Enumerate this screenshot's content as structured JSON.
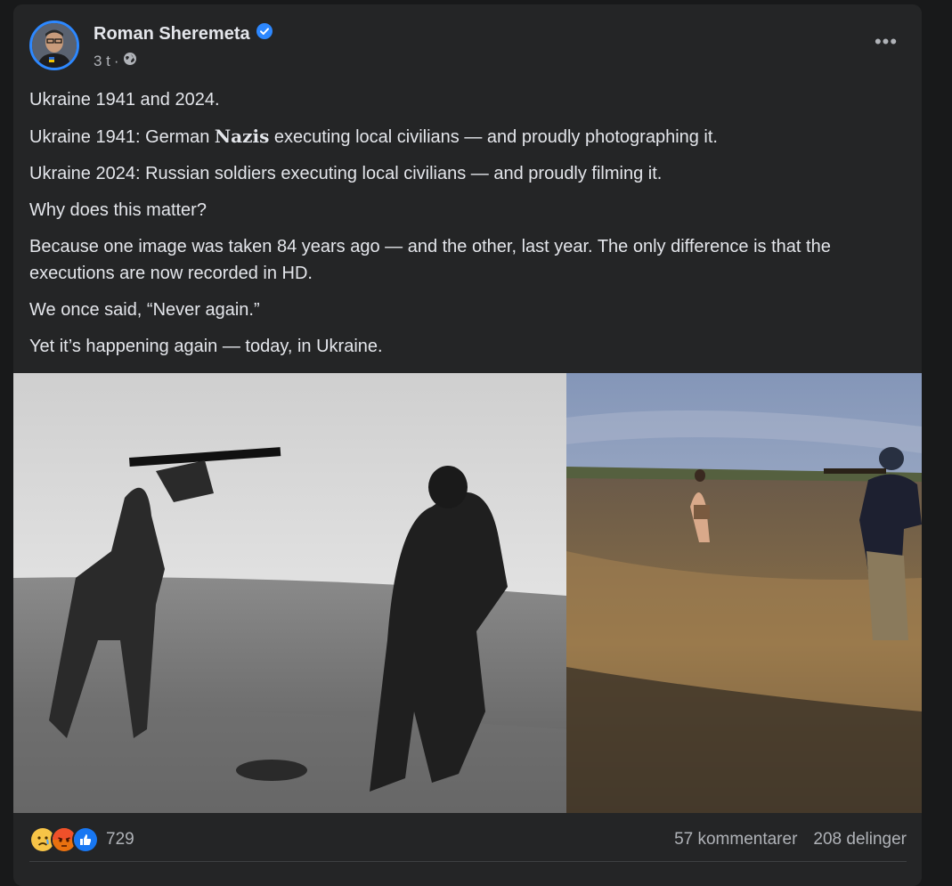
{
  "post": {
    "author": "Roman Sheremeta",
    "time": "3 t",
    "separator": "·",
    "paragraphs": {
      "p1": "Ukraine 1941 and 2024.",
      "p2_a": "Ukraine 1941: German ",
      "p2_b": "Nazis",
      "p2_c": " executing local civilians — and proudly photographing it.",
      "p3": "Ukraine 2024: Russian soldiers executing local civilians — and proudly filming it.",
      "p4": "Why does this matter?",
      "p5": "Because one image was taken 84 years ago — and the other, last year. The only difference is that the executions are now recorded in HD.",
      "p6": "We once said, “Never again.”",
      "p7": "Yet it’s happening again — today, in Ukraine."
    },
    "reaction_count": "729",
    "comments": "57 kommentarer",
    "shares": "208 delinger",
    "icons": {
      "verified": "verified-badge-icon",
      "audience": "globe-icon",
      "menu": "more-options-icon",
      "reactions": [
        "sad-reaction-icon",
        "angry-reaction-icon",
        "like-reaction-icon"
      ]
    },
    "colors": {
      "accent": "#2d88ff",
      "bg": "#242526",
      "text": "#e4e6eb",
      "muted": "#b0b3b8"
    }
  }
}
